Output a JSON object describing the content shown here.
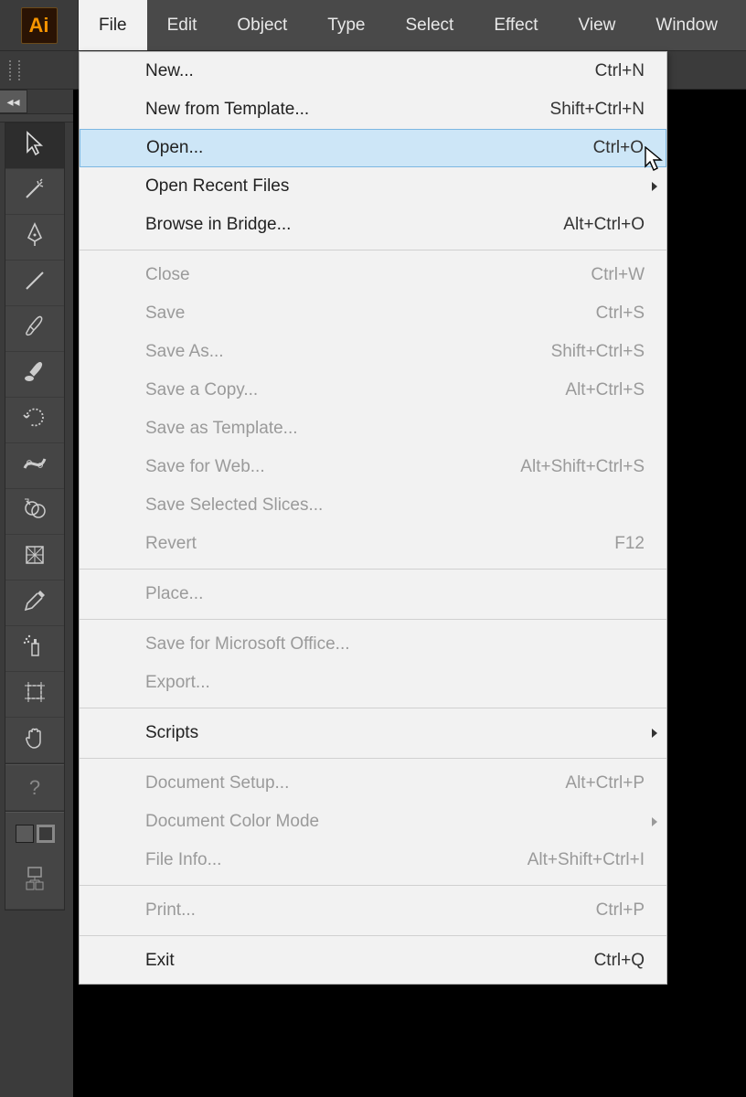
{
  "menubar": {
    "items": [
      {
        "label": "File",
        "active": true
      },
      {
        "label": "Edit"
      },
      {
        "label": "Object"
      },
      {
        "label": "Type"
      },
      {
        "label": "Select"
      },
      {
        "label": "Effect"
      },
      {
        "label": "View"
      },
      {
        "label": "Window"
      }
    ]
  },
  "dropdown": {
    "items": [
      {
        "kind": "item",
        "label": "New...",
        "shortcut": "Ctrl+N"
      },
      {
        "kind": "item",
        "label": "New from Template...",
        "shortcut": "Shift+Ctrl+N"
      },
      {
        "kind": "item",
        "label": "Open...",
        "shortcut": "Ctrl+O",
        "highlight": true
      },
      {
        "kind": "item",
        "label": "Open Recent Files",
        "submenu": true
      },
      {
        "kind": "item",
        "label": "Browse in Bridge...",
        "shortcut": "Alt+Ctrl+O"
      },
      {
        "kind": "sep"
      },
      {
        "kind": "item",
        "label": "Close",
        "shortcut": "Ctrl+W",
        "disabled": true
      },
      {
        "kind": "item",
        "label": "Save",
        "shortcut": "Ctrl+S",
        "disabled": true
      },
      {
        "kind": "item",
        "label": "Save As...",
        "shortcut": "Shift+Ctrl+S",
        "disabled": true
      },
      {
        "kind": "item",
        "label": "Save a Copy...",
        "shortcut": "Alt+Ctrl+S",
        "disabled": true
      },
      {
        "kind": "item",
        "label": "Save as Template...",
        "disabled": true
      },
      {
        "kind": "item",
        "label": "Save for Web...",
        "shortcut": "Alt+Shift+Ctrl+S",
        "disabled": true
      },
      {
        "kind": "item",
        "label": "Save Selected Slices...",
        "disabled": true
      },
      {
        "kind": "item",
        "label": "Revert",
        "shortcut": "F12",
        "disabled": true
      },
      {
        "kind": "sep"
      },
      {
        "kind": "item",
        "label": "Place...",
        "disabled": true
      },
      {
        "kind": "sep"
      },
      {
        "kind": "item",
        "label": "Save for Microsoft Office...",
        "disabled": true
      },
      {
        "kind": "item",
        "label": "Export...",
        "disabled": true
      },
      {
        "kind": "sep"
      },
      {
        "kind": "item",
        "label": "Scripts",
        "submenu": true
      },
      {
        "kind": "sep"
      },
      {
        "kind": "item",
        "label": "Document Setup...",
        "shortcut": "Alt+Ctrl+P",
        "disabled": true
      },
      {
        "kind": "item",
        "label": "Document Color Mode",
        "submenu": true,
        "disabled": true
      },
      {
        "kind": "item",
        "label": "File Info...",
        "shortcut": "Alt+Shift+Ctrl+I",
        "disabled": true
      },
      {
        "kind": "sep"
      },
      {
        "kind": "item",
        "label": "Print...",
        "shortcut": "Ctrl+P",
        "disabled": true
      },
      {
        "kind": "sep"
      },
      {
        "kind": "item",
        "label": "Exit",
        "shortcut": "Ctrl+Q"
      }
    ]
  },
  "toolbox": {
    "tools": [
      {
        "name": "selection-tool",
        "icon": "cursor",
        "active": true
      },
      {
        "name": "magic-wand-tool",
        "icon": "wand"
      },
      {
        "name": "pen-tool",
        "icon": "pen"
      },
      {
        "name": "line-segment-tool",
        "icon": "line"
      },
      {
        "name": "paintbrush-tool",
        "icon": "brush"
      },
      {
        "name": "blob-brush-tool",
        "icon": "blob"
      },
      {
        "name": "rotate-tool",
        "icon": "rotate"
      },
      {
        "name": "width-tool",
        "icon": "width"
      },
      {
        "name": "shape-builder-tool",
        "icon": "shapebuilder"
      },
      {
        "name": "mesh-tool",
        "icon": "mesh"
      },
      {
        "name": "eyedropper-tool",
        "icon": "eyedropper"
      },
      {
        "name": "symbol-sprayer-tool",
        "icon": "sprayer"
      },
      {
        "name": "artboard-tool",
        "icon": "artboard"
      },
      {
        "name": "hand-tool",
        "icon": "hand"
      },
      {
        "name": "help-button",
        "icon": "help",
        "divider_before": true
      }
    ]
  },
  "logo_text": "Ai",
  "chevron_label": "◂◂"
}
